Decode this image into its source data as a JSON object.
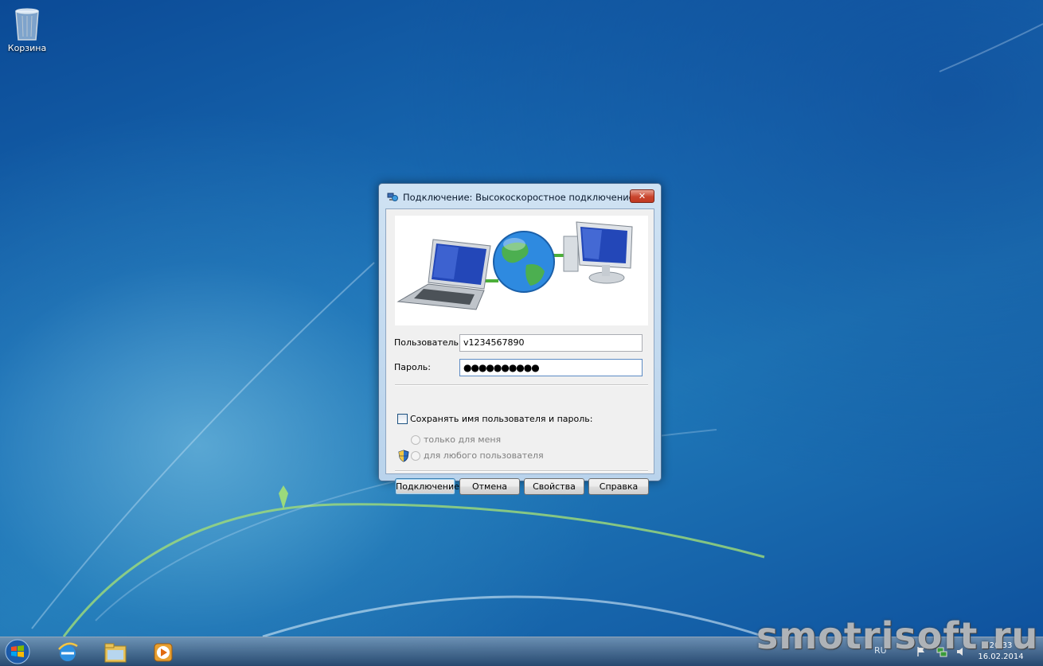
{
  "desktop": {
    "icons": [
      {
        "label": "Корзина",
        "icon": "recycle-bin-icon"
      }
    ]
  },
  "dialog": {
    "title": "Подключение: Высокоскоростное подключение",
    "close_symbol": "✕",
    "user_label": "Пользователь:",
    "user_value": "v1234567890",
    "password_label": "Пароль:",
    "password_value": "●●●●●●●●●●",
    "save_checkbox_label": "Сохранять имя пользователя и пароль:",
    "save_checked": false,
    "radio_only_me": "только для меня",
    "radio_any_user": "для любого пользователя",
    "buttons": {
      "connect": "Подключение",
      "cancel": "Отмена",
      "properties": "Свойства",
      "help": "Справка"
    }
  },
  "taskbar": {
    "items": [
      "start-orb-icon",
      "internet-explorer-icon",
      "file-explorer-icon",
      "media-player-icon"
    ],
    "language": "RU",
    "time": "20:33",
    "date": "16.02.2014"
  },
  "watermark": "smotrisoft.ru"
}
